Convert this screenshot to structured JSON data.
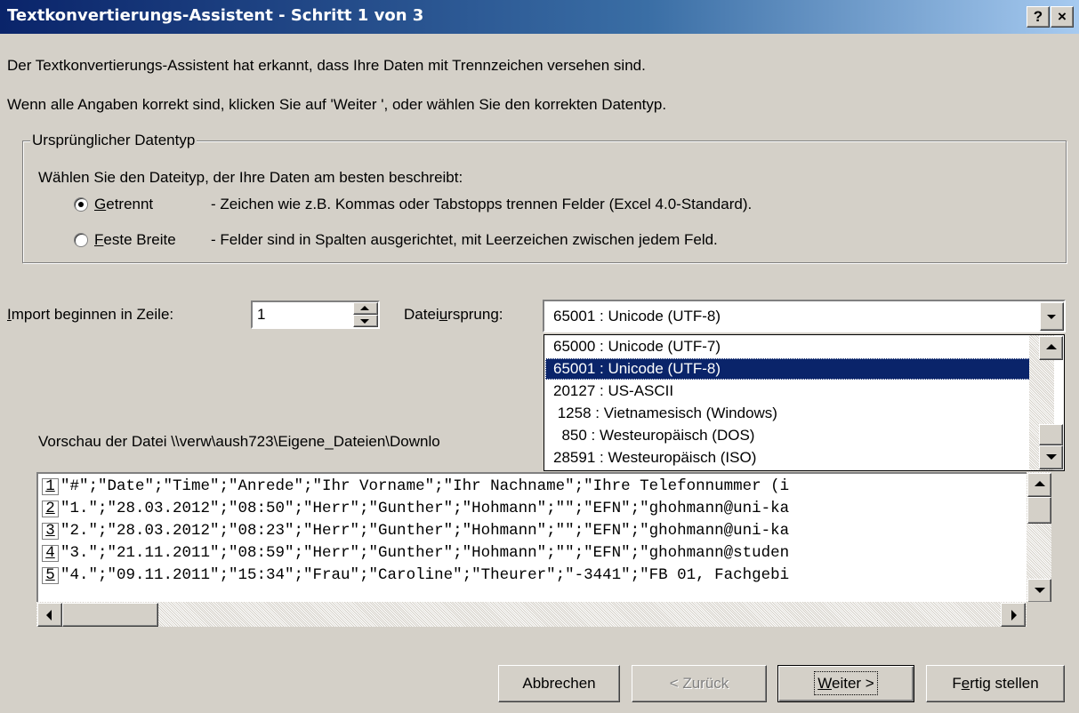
{
  "window": {
    "title": "Textkonvertierungs-Assistent - Schritt 1 von 3",
    "help_label": "?",
    "close_label": "×"
  },
  "intro": {
    "line1": "Der Textkonvertierungs-Assistent hat erkannt, dass Ihre Daten mit Trennzeichen versehen sind.",
    "line2": "Wenn alle Angaben korrekt sind, klicken Sie auf 'Weiter ', oder wählen Sie den korrekten Datentyp."
  },
  "datatype_group": {
    "label": "Ursprünglicher Datentyp",
    "prompt": "Wählen Sie den Dateityp, der Ihre Daten am besten beschreibt:",
    "options": [
      {
        "accel": "G",
        "label_rest": "etrennt",
        "description": "- Zeichen wie z.B. Kommas oder Tabstopps trennen Felder (Excel 4.0-Standard).",
        "selected": true
      },
      {
        "accel": "F",
        "label_rest": "este Breite",
        "description": "- Felder sind in Spalten ausgerichtet, mit Leerzeichen zwischen jedem Feld.",
        "selected": false
      }
    ]
  },
  "import_row": {
    "label_accel": "I",
    "label_rest": "mport beginnen in Zeile:",
    "value": "1"
  },
  "origin": {
    "label_pre": "Datei",
    "label_accel": "u",
    "label_post": "rsprung:",
    "selected": "65001 : Unicode (UTF-8)",
    "options": [
      "65000 : Unicode (UTF-7)",
      "65001 : Unicode (UTF-8)",
      "20127 : US-ASCII",
      " 1258 : Vietnamesisch (Windows)",
      "  850 : Westeuropäisch (DOS)",
      "28591 : Westeuropäisch (ISO)"
    ],
    "selected_index": 1
  },
  "preview": {
    "label": "Vorschau der Datei \\\\verw\\aush723\\Eigene_Dateien\\Downlo",
    "rows": [
      {
        "num": "1",
        "text": "\"#\";\"Date\";\"Time\";\"Anrede\";\"Ihr Vorname\";\"Ihr Nachname\";\"Ihre Telefonnummer (i"
      },
      {
        "num": "2",
        "text": "\"1.\";\"28.03.2012\";\"08:50\";\"Herr\";\"Gunther\";\"Hohmann\";\"\";\"EFN\";\"ghohmann@uni-ka"
      },
      {
        "num": "3",
        "text": "\"2.\";\"28.03.2012\";\"08:23\";\"Herr\";\"Gunther\";\"Hohmann\";\"\";\"EFN\";\"ghohmann@uni-ka"
      },
      {
        "num": "4",
        "text": "\"3.\";\"21.11.2011\";\"08:59\";\"Herr\";\"Gunther\";\"Hohmann\";\"\";\"EFN\";\"ghohmann@studen"
      },
      {
        "num": "5",
        "text": "\"4.\";\"09.11.2011\";\"15:34\";\"Frau\";\"Caroline\";\"Theurer\";\"-3441\";\"FB 01, Fachgebi"
      }
    ]
  },
  "buttons": {
    "cancel": "Abbrechen",
    "back": "< Zurück",
    "next_accel": "W",
    "next_rest": "eiter >",
    "finish_pre": "F",
    "finish_accel": "e",
    "finish_post": "rtig stellen"
  },
  "colors": {
    "face": "#d4d0c8",
    "title_start": "#0a246a",
    "title_end": "#a6caf0",
    "selection": "#0a246a"
  }
}
